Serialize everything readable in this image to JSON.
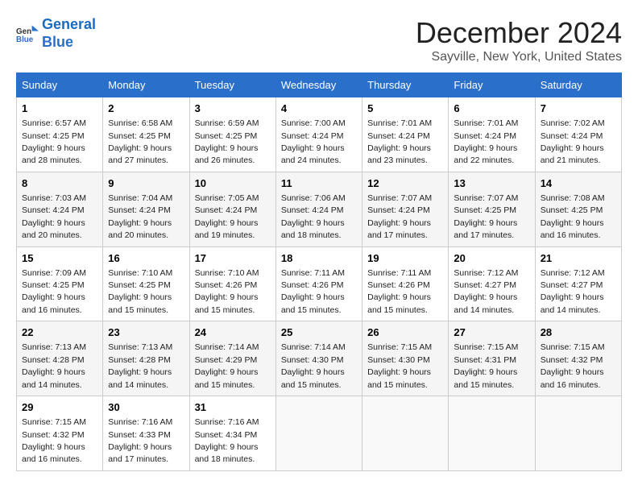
{
  "logo": {
    "line1": "General",
    "line2": "Blue"
  },
  "title": "December 2024",
  "location": "Sayville, New York, United States",
  "weekdays": [
    "Sunday",
    "Monday",
    "Tuesday",
    "Wednesday",
    "Thursday",
    "Friday",
    "Saturday"
  ],
  "weeks": [
    [
      {
        "day": "1",
        "sunrise": "6:57 AM",
        "sunset": "4:25 PM",
        "daylight": "9 hours and 28 minutes."
      },
      {
        "day": "2",
        "sunrise": "6:58 AM",
        "sunset": "4:25 PM",
        "daylight": "9 hours and 27 minutes."
      },
      {
        "day": "3",
        "sunrise": "6:59 AM",
        "sunset": "4:25 PM",
        "daylight": "9 hours and 26 minutes."
      },
      {
        "day": "4",
        "sunrise": "7:00 AM",
        "sunset": "4:24 PM",
        "daylight": "9 hours and 24 minutes."
      },
      {
        "day": "5",
        "sunrise": "7:01 AM",
        "sunset": "4:24 PM",
        "daylight": "9 hours and 23 minutes."
      },
      {
        "day": "6",
        "sunrise": "7:01 AM",
        "sunset": "4:24 PM",
        "daylight": "9 hours and 22 minutes."
      },
      {
        "day": "7",
        "sunrise": "7:02 AM",
        "sunset": "4:24 PM",
        "daylight": "9 hours and 21 minutes."
      }
    ],
    [
      {
        "day": "8",
        "sunrise": "7:03 AM",
        "sunset": "4:24 PM",
        "daylight": "9 hours and 20 minutes."
      },
      {
        "day": "9",
        "sunrise": "7:04 AM",
        "sunset": "4:24 PM",
        "daylight": "9 hours and 20 minutes."
      },
      {
        "day": "10",
        "sunrise": "7:05 AM",
        "sunset": "4:24 PM",
        "daylight": "9 hours and 19 minutes."
      },
      {
        "day": "11",
        "sunrise": "7:06 AM",
        "sunset": "4:24 PM",
        "daylight": "9 hours and 18 minutes."
      },
      {
        "day": "12",
        "sunrise": "7:07 AM",
        "sunset": "4:24 PM",
        "daylight": "9 hours and 17 minutes."
      },
      {
        "day": "13",
        "sunrise": "7:07 AM",
        "sunset": "4:25 PM",
        "daylight": "9 hours and 17 minutes."
      },
      {
        "day": "14",
        "sunrise": "7:08 AM",
        "sunset": "4:25 PM",
        "daylight": "9 hours and 16 minutes."
      }
    ],
    [
      {
        "day": "15",
        "sunrise": "7:09 AM",
        "sunset": "4:25 PM",
        "daylight": "9 hours and 16 minutes."
      },
      {
        "day": "16",
        "sunrise": "7:10 AM",
        "sunset": "4:25 PM",
        "daylight": "9 hours and 15 minutes."
      },
      {
        "day": "17",
        "sunrise": "7:10 AM",
        "sunset": "4:26 PM",
        "daylight": "9 hours and 15 minutes."
      },
      {
        "day": "18",
        "sunrise": "7:11 AM",
        "sunset": "4:26 PM",
        "daylight": "9 hours and 15 minutes."
      },
      {
        "day": "19",
        "sunrise": "7:11 AM",
        "sunset": "4:26 PM",
        "daylight": "9 hours and 15 minutes."
      },
      {
        "day": "20",
        "sunrise": "7:12 AM",
        "sunset": "4:27 PM",
        "daylight": "9 hours and 14 minutes."
      },
      {
        "day": "21",
        "sunrise": "7:12 AM",
        "sunset": "4:27 PM",
        "daylight": "9 hours and 14 minutes."
      }
    ],
    [
      {
        "day": "22",
        "sunrise": "7:13 AM",
        "sunset": "4:28 PM",
        "daylight": "9 hours and 14 minutes."
      },
      {
        "day": "23",
        "sunrise": "7:13 AM",
        "sunset": "4:28 PM",
        "daylight": "9 hours and 14 minutes."
      },
      {
        "day": "24",
        "sunrise": "7:14 AM",
        "sunset": "4:29 PM",
        "daylight": "9 hours and 15 minutes."
      },
      {
        "day": "25",
        "sunrise": "7:14 AM",
        "sunset": "4:30 PM",
        "daylight": "9 hours and 15 minutes."
      },
      {
        "day": "26",
        "sunrise": "7:15 AM",
        "sunset": "4:30 PM",
        "daylight": "9 hours and 15 minutes."
      },
      {
        "day": "27",
        "sunrise": "7:15 AM",
        "sunset": "4:31 PM",
        "daylight": "9 hours and 15 minutes."
      },
      {
        "day": "28",
        "sunrise": "7:15 AM",
        "sunset": "4:32 PM",
        "daylight": "9 hours and 16 minutes."
      }
    ],
    [
      {
        "day": "29",
        "sunrise": "7:15 AM",
        "sunset": "4:32 PM",
        "daylight": "9 hours and 16 minutes."
      },
      {
        "day": "30",
        "sunrise": "7:16 AM",
        "sunset": "4:33 PM",
        "daylight": "9 hours and 17 minutes."
      },
      {
        "day": "31",
        "sunrise": "7:16 AM",
        "sunset": "4:34 PM",
        "daylight": "9 hours and 18 minutes."
      },
      null,
      null,
      null,
      null
    ]
  ]
}
